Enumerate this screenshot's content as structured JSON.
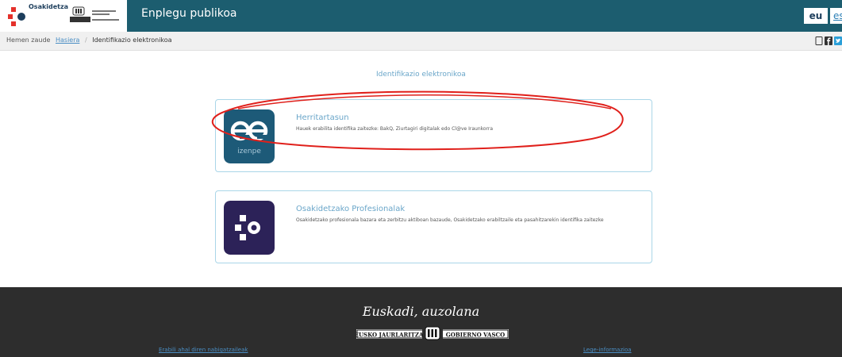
{
  "header": {
    "org_name": "Osakidetza",
    "app_title": "Enplegu publikoa",
    "lang_active": "eu",
    "lang_other": "es",
    "icons": {
      "logo": "osakidetza-logo-icon",
      "gov": "basque-government-emblem-icon"
    }
  },
  "breadcrumb": {
    "prefix": "Hemen zaude",
    "home": "Hasiera",
    "separator": "/",
    "current": "Identifikazio elektronikoa"
  },
  "share": {
    "icons": [
      "mobile-icon",
      "facebook-icon",
      "twitter-icon"
    ]
  },
  "main": {
    "heading": "Identifikazio elektronikoa",
    "cards": [
      {
        "title": "Herritartasun",
        "text": "Hauek erabilita identifika zaitezke: BakQ, Ziurtagiri digitalak edo Cl@ve Iraunkorra",
        "logo_text": "izenpe",
        "logo_icon": "izenpe-logo-icon",
        "logo_color": "#1d5a78"
      },
      {
        "title": "Osakidetzako Profesionalak",
        "text": "Osakidetzako profesionala bazara eta zerbitzu aktiboan bazaude, Osakidetzako erabiltzaile eta pasahitzarekin identifika zaitezke",
        "logo_icon": "osakidetza-logo-icon",
        "logo_color": "#2c2258"
      }
    ]
  },
  "footer": {
    "motto": "Euskadi, auzolana",
    "badge_left": "EUSKO JAURLARITZA",
    "badge_right": "GOBIERNO VASCO",
    "links": [
      "Erabili ahal diren nabigatzaileak",
      "Lege-informazioa"
    ]
  },
  "colors": {
    "header_bg": "#1c5d6f",
    "accent": "#6aa6c9",
    "annotation": "#e0201b",
    "footer_bg": "#2d2d2d"
  }
}
